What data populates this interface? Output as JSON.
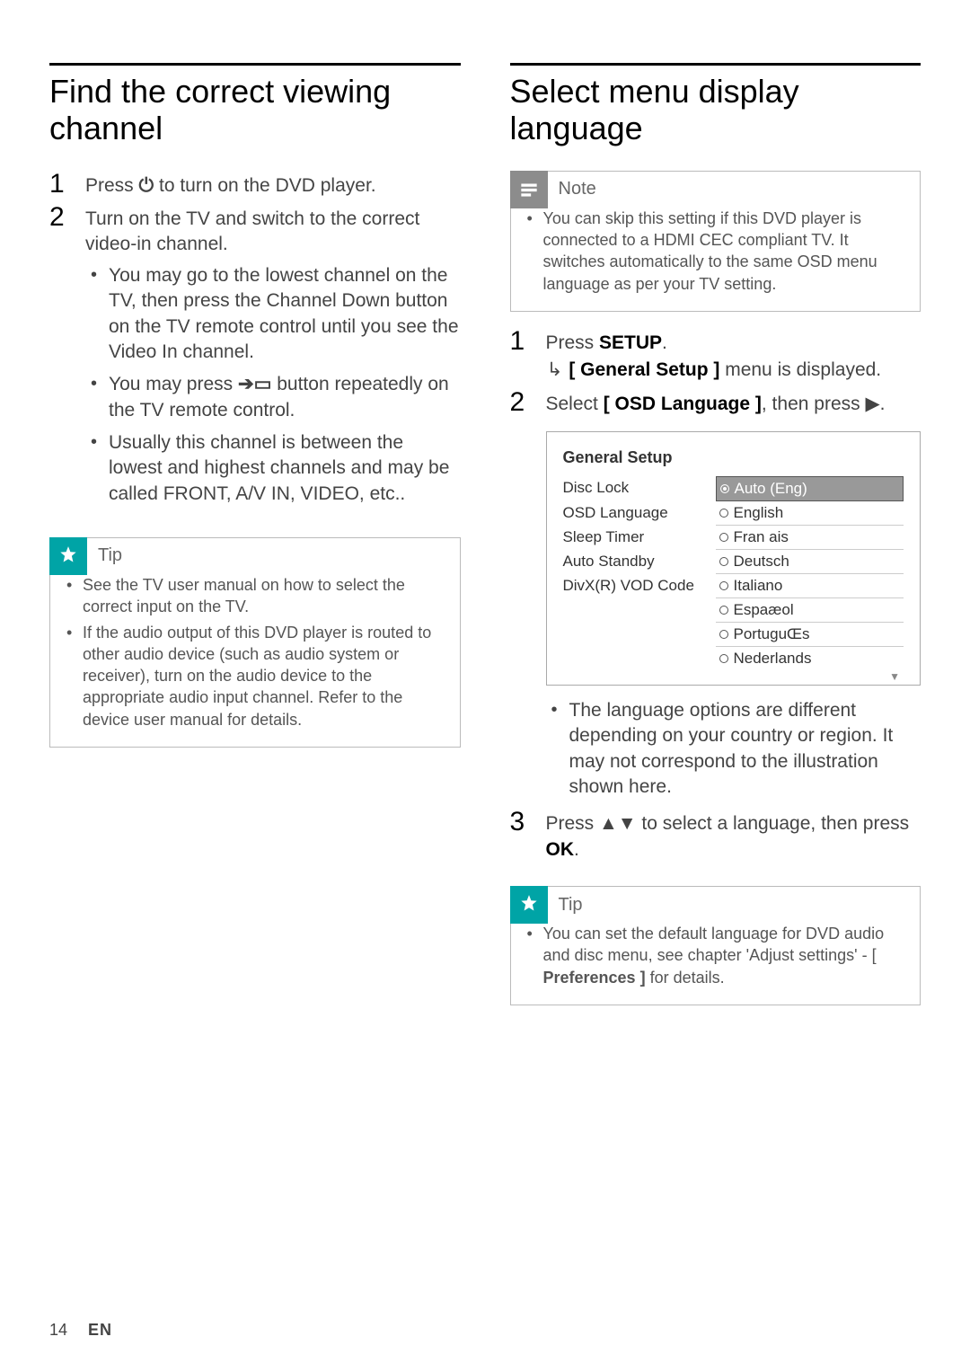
{
  "left": {
    "heading": "Find the correct viewing channel",
    "step1_pre": "Press ",
    "step1_post": " to turn on the DVD player.",
    "step2": "Turn on the TV and switch to the correct video-in channel.",
    "bullets": [
      "You may go to the lowest channel on the TV, then press the Channel Down button on the TV remote control until you see the Video In channel.",
      "You may press  ",
      " button repeatedly on the TV remote control.",
      "Usually this channel is between the lowest and highest channels and may be called FRONT, A/V IN, VIDEO, etc.."
    ],
    "tip_title": "Tip",
    "tips": [
      "See the TV user manual on how to select the correct input on the TV.",
      "If the audio output of this DVD player is routed to other audio device (such as audio system or receiver), turn on the audio device to the appropriate audio input channel. Refer to the device user manual for details."
    ]
  },
  "right": {
    "heading": "Select menu display language",
    "note_title": "Note",
    "note_text": "You can skip this setting if this DVD player is connected to a HDMI CEC compliant TV. It switches automatically to the same OSD menu language as per your TV setting.",
    "step1_pre": "Press ",
    "step1_bold": "SETUP",
    "step1_result_pre": "[ General Setup ]",
    "step1_result_post": " menu is displayed.",
    "step2_pre": "Select ",
    "step2_bold": "[ OSD Language ]",
    "step2_mid": ", then press ",
    "step2_post": ".",
    "menu_title": "General Setup",
    "menu_left": [
      "Disc Lock",
      "OSD Language",
      "Sleep Timer",
      "Auto Standby",
      "DivX(R) VOD Code"
    ],
    "menu_right": [
      "Auto (Eng)",
      "English",
      "Fran ais",
      "Deutsch",
      "Italiano",
      "Espaæol",
      "PortuguŒs",
      "Nederlands"
    ],
    "lang_note": "The language options are different depending on your country or region. It may not correspond to the illustration shown here.",
    "step3_pre": "Press ",
    "step3_mid": " to select a language, then press ",
    "step3_bold": "OK",
    "step3_post": ".",
    "tip_title": "Tip",
    "tip_text_pre": "You can set the default language for DVD audio and disc menu, see chapter 'Adjust settings' - [ ",
    "tip_text_bold": "Preferences ]",
    "tip_text_post": " for details."
  },
  "footer": {
    "page": "14",
    "lang": "EN"
  }
}
